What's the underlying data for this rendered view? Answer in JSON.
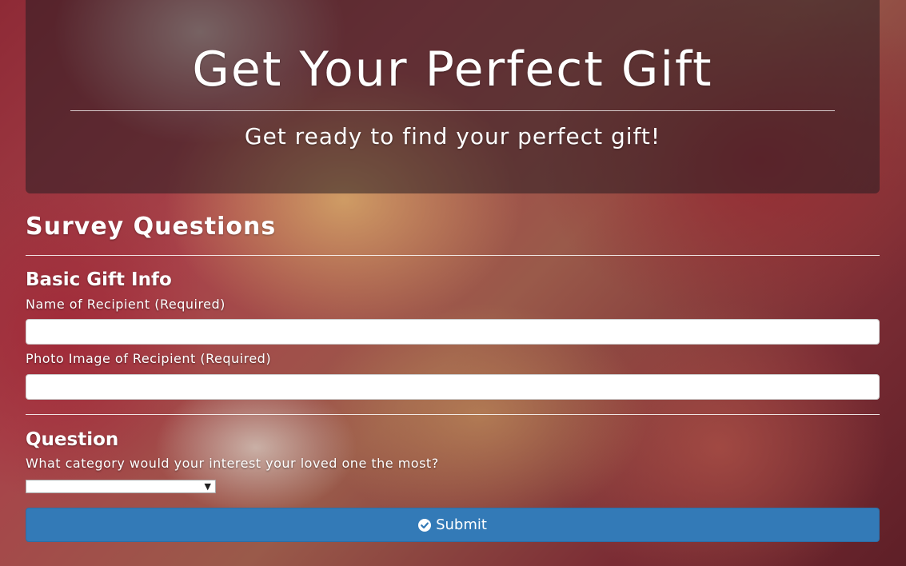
{
  "hero": {
    "title": "Get Your Perfect Gift",
    "subtitle": "Get ready to find your perfect gift!"
  },
  "survey": {
    "title": "Survey Questions"
  },
  "basic_info": {
    "heading": "Basic Gift Info",
    "name_label": "Name of Recipient (Required)",
    "name_value": "",
    "photo_label": "Photo Image of Recipient (Required)",
    "photo_value": ""
  },
  "question": {
    "heading": "Question",
    "prompt": "What category would your interest your loved one the most?",
    "selected": ""
  },
  "submit": {
    "label": "Submit",
    "icon": "check-circle-icon",
    "color": "#337ab7"
  }
}
